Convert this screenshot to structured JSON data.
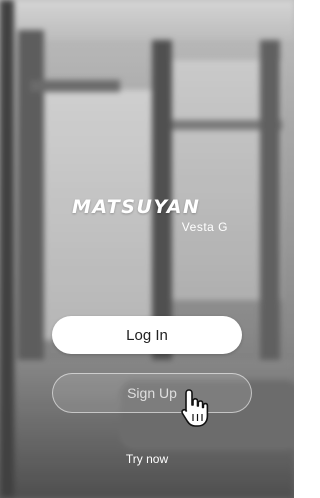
{
  "brand": {
    "name": "MATSUYAN",
    "subtitle": "Vesta G"
  },
  "actions": {
    "login_label": "Log In",
    "signup_label": "Sign Up",
    "try_now_label": "Try now"
  },
  "cursor": {
    "icon": "hand-pointer-icon"
  },
  "colors": {
    "primary_button_bg": "#ffffff",
    "primary_button_text": "#222222",
    "secondary_button_border": "#ffffff",
    "text_on_background": "#ffffff"
  }
}
